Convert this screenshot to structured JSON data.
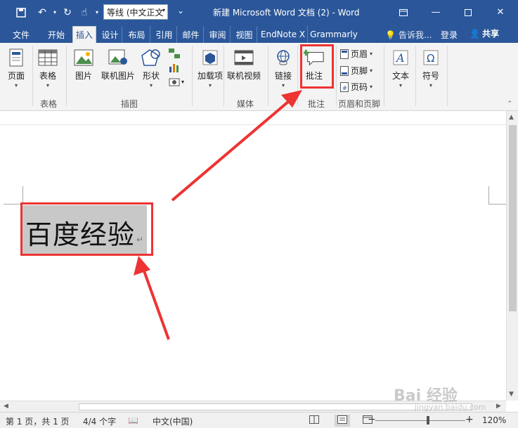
{
  "app": {
    "title": "新建 Microsoft Word 文档 (2) - Word",
    "font_name": "等线 (中文正文",
    "accent": "#2b579a"
  },
  "tabs": [
    {
      "label": "文件"
    },
    {
      "label": "开始"
    },
    {
      "label": "插入",
      "active": true
    },
    {
      "label": "设计"
    },
    {
      "label": "布局"
    },
    {
      "label": "引用"
    },
    {
      "label": "邮件"
    },
    {
      "label": "审阅"
    },
    {
      "label": "视图"
    },
    {
      "label": "EndNote X"
    },
    {
      "label": "Grammarly"
    }
  ],
  "tell_me": "告诉我...",
  "login": "登录",
  "share": "共享",
  "ribbon": {
    "page": "页面",
    "table": "表格",
    "table_group": "表格",
    "picture": "图片",
    "online_picture": "联机图片",
    "shapes": "形状",
    "illustrations_group": "插图",
    "addins": "加载项",
    "online_video": "联机视频",
    "media_group": "媒体",
    "link": "链接",
    "comment": "批注",
    "comments_group": "批注",
    "header": "页眉",
    "footer": "页脚",
    "page_number": "页码",
    "header_footer_group": "页眉和页脚",
    "text": "文本",
    "symbol": "符号"
  },
  "document": {
    "selected_text": "百度经验"
  },
  "status": {
    "page": "第 1 页，共 1 页",
    "words": "4/4 个字",
    "language": "中文(中国)",
    "zoom": "120%"
  },
  "watermark": {
    "logo": "Bai 经验",
    "url": "jingyan.baidu.com"
  },
  "annotation_color": "#e33"
}
